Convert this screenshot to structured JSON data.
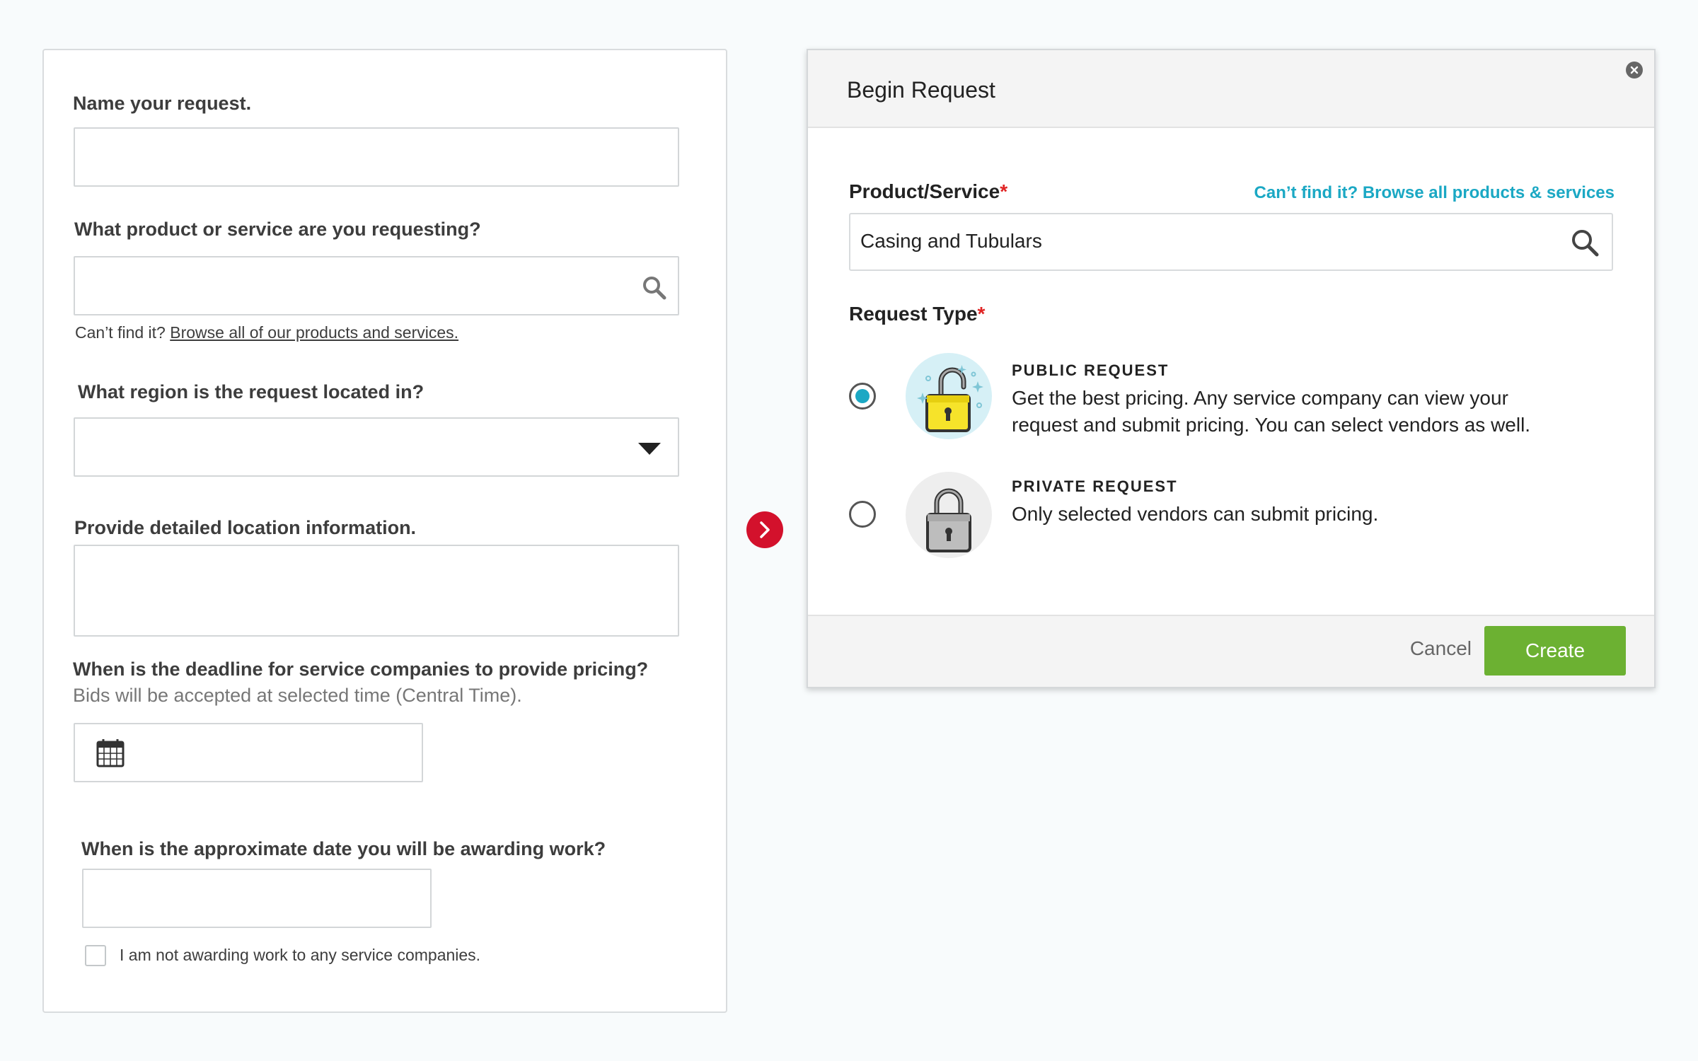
{
  "form": {
    "name_label": "Name your request.",
    "product_label": "What product or service are you requesting?",
    "product_help_prefix": "Can’t find it?",
    "product_help_link": "Browse all of our products and services.",
    "region_label": "What region is the request located in?",
    "location_label": "Provide detailed location information.",
    "deadline_label": "When is the deadline for service companies to provide pricing?",
    "deadline_sub": "Bids will be accepted at selected time (Central Time).",
    "award_label": "When is the approximate date you will be awarding work?",
    "not_awarding_label": "I am not awarding work to any service companies."
  },
  "modal": {
    "title": "Begin Request",
    "product_label": "Product/Service",
    "required_mark": "*",
    "browse_link": "Can’t find it? Browse all products & services",
    "product_value": "Casing and Tubulars",
    "request_type_label": "Request Type",
    "options": [
      {
        "title": "PUBLIC REQUEST",
        "description": "Get the best pricing. Any service company can view your request and submit pricing. You can select vendors as well.",
        "selected": true
      },
      {
        "title": "PRIVATE REQUEST",
        "description": "Only selected vendors can submit pricing.",
        "selected": false
      }
    ],
    "cancel_label": "Cancel",
    "create_label": "Create"
  },
  "colors": {
    "accent": "#1ba8c4",
    "create_green": "#6cb132",
    "arrow_red": "#d3112c",
    "required_red": "#e02424"
  },
  "icons": [
    "search-icon",
    "caret-down-icon",
    "calendar-icon",
    "chevron-right-icon",
    "close-icon",
    "unlocked-padlock-icon",
    "locked-padlock-icon"
  ]
}
